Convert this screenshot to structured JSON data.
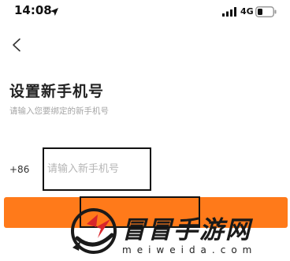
{
  "status_bar": {
    "time": "14:08",
    "network": "4G",
    "icons": [
      "location-arrow-icon",
      "signal-bars-icon",
      "battery-icon"
    ]
  },
  "nav": {
    "back_icon": "chevron-left-icon"
  },
  "page": {
    "title": "设置新手机号",
    "subtitle": "请输入您要绑定的新手机号"
  },
  "phone_field": {
    "country_code": "+86",
    "value": "",
    "placeholder": "请输入新手机号"
  },
  "submit_button": {
    "label": "",
    "color": "#ff7a1a"
  },
  "watermark": {
    "title": "冒冒手游网",
    "url": "meiweida.com"
  },
  "colors": {
    "accent": "#ff7a1a",
    "title_text": "#222222",
    "hint_text": "#a6a6a6"
  }
}
